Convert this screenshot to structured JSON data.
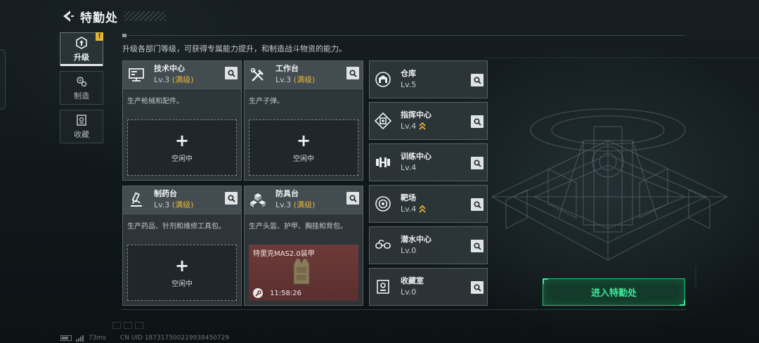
{
  "header": {
    "title": "特勤处"
  },
  "nav": {
    "items": [
      {
        "label": "升级",
        "badge": "!"
      },
      {
        "label": "制造"
      },
      {
        "label": "收藏"
      }
    ]
  },
  "intro": "升级各部门等级，可获得专属能力提升，和制造战斗物资的能力。",
  "workbenches": [
    {
      "name": "技术中心",
      "level": "Lv.3",
      "max_tag": "(满级)",
      "desc": "生产枪械和配件。",
      "slot_plus": "+",
      "slot_label": "空闲中"
    },
    {
      "name": "工作台",
      "level": "Lv.3",
      "max_tag": "(满级)",
      "desc": "生产子弹。",
      "slot_plus": "+",
      "slot_label": "空闲中"
    },
    {
      "name": "制药台",
      "level": "Lv.3",
      "max_tag": "(满级)",
      "desc": "生产药品、针剂和维修工具包。",
      "slot_plus": "+",
      "slot_label": "空闲中"
    },
    {
      "name": "防具台",
      "level": "Lv.3",
      "max_tag": "(满级)",
      "desc": "生产头盔、护甲、胸挂和背包。",
      "craft_item": "特里克MAS2.0装甲",
      "craft_time": "11:58:26"
    }
  ],
  "facilities": [
    {
      "name": "仓库",
      "level": "Lv.5",
      "upgradable": false
    },
    {
      "name": "指挥中心",
      "level": "Lv.4",
      "upgradable": true
    },
    {
      "name": "训练中心",
      "level": "Lv.4",
      "upgradable": false
    },
    {
      "name": "靶场",
      "level": "Lv.4",
      "upgradable": true
    },
    {
      "name": "潜水中心",
      "level": "Lv.0",
      "upgradable": false
    },
    {
      "name": "收藏室",
      "level": "Lv.0",
      "upgradable": false
    }
  ],
  "enter_button": "进入特勤处",
  "footer": {
    "ping": "73ms",
    "uid": "CN UID 1873175002199384507​29"
  },
  "colors": {
    "accent_green": "#3ee89a",
    "max_gold": "#e3b43a"
  }
}
